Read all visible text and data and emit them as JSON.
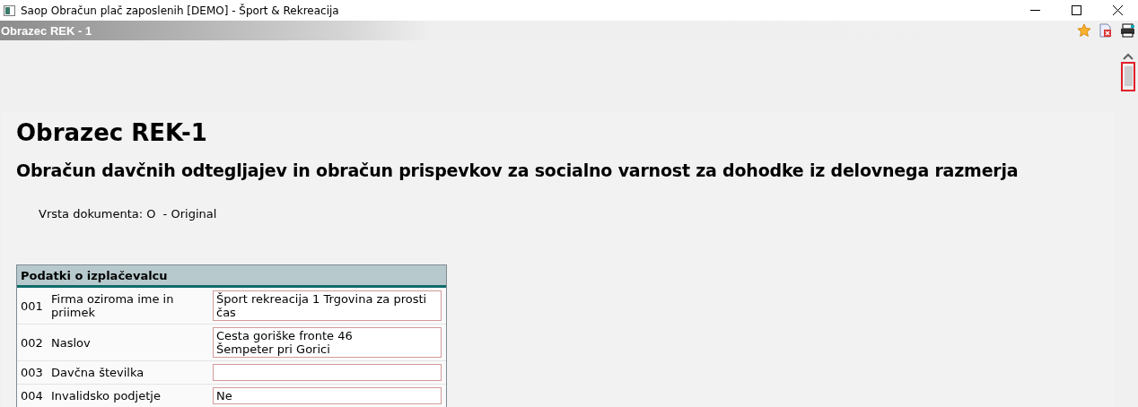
{
  "window": {
    "title": "Saop Obračun plač zaposlenih [DEMO] - Šport & Rekreacija"
  },
  "header": {
    "title": "Obrazec REK - 1"
  },
  "document": {
    "title": "Obrazec REK-1",
    "subtitle": "Obračun davčnih odtegljajev in obračun prispevkov za socialno varnost za dohodke iz delovnega razmerja",
    "document_type_label": "Vrsta dokumenta:",
    "document_type_value": "O  - Original"
  },
  "payer_table": {
    "heading": "Podatki o izplačevalcu",
    "rows": [
      {
        "code": "001",
        "label": "Firma oziroma ime in priimek",
        "value": "Šport rekreacija 1 Trgovina za prosti čas"
      },
      {
        "code": "002",
        "label": "Naslov",
        "value": "Cesta goriške fronte 46\nŠempeter pri Gorici"
      },
      {
        "code": "003",
        "label": "Davčna številka",
        "value": ""
      },
      {
        "code": "004",
        "label": "Invalidsko podjetje",
        "value": "Ne"
      }
    ]
  }
}
